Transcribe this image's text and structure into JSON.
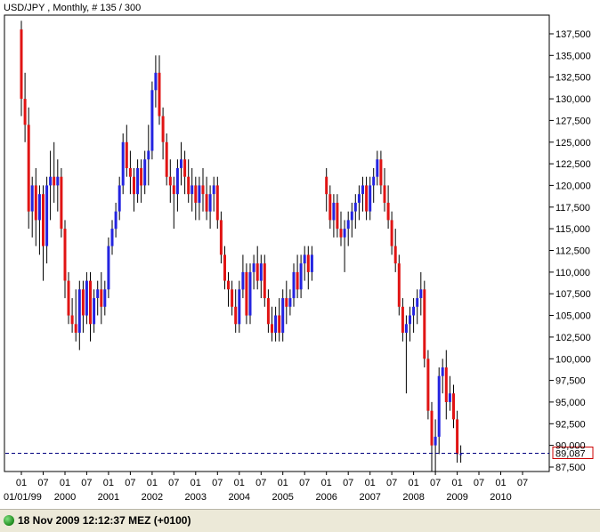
{
  "window": {
    "title": "USD/JPY , Monthly, # 135 / 300"
  },
  "status": {
    "text": "18 Nov 2009 12:12:37  MEZ (+0100)"
  },
  "colors": {
    "up": "#2424e0",
    "down": "#e01414",
    "wick": "#000000",
    "price_line": "#000080",
    "price_box": "#cc0000"
  },
  "chart_data": {
    "type": "candlestick",
    "symbol": "USD/JPY",
    "timeframe": "Monthly",
    "current_price": 89.087,
    "current_price_label": "89,087",
    "ylim": [
      86.5,
      139
    ],
    "y_ticks": [
      87.5,
      90,
      92.5,
      95,
      97.5,
      100,
      102.5,
      105,
      107.5,
      110,
      112.5,
      115,
      117.5,
      120,
      122.5,
      125,
      127.5,
      130,
      132.5,
      135,
      137.5
    ],
    "y_tick_labels": [
      "87,500",
      "90,000",
      "92,500",
      "95,000",
      "97,500",
      "100,000",
      "102,500",
      "105,000",
      "107,500",
      "110,000",
      "112,500",
      "115,000",
      "117,500",
      "120,000",
      "122,500",
      "125,000",
      "127,500",
      "130,000",
      "132,500",
      "135,000",
      "137,500"
    ],
    "month_ticks": [
      {
        "month": 1,
        "label": "01"
      },
      {
        "month": 7,
        "label": "07"
      },
      {
        "month": 13,
        "label": "01"
      },
      {
        "month": 19,
        "label": "07"
      },
      {
        "month": 25,
        "label": "01"
      },
      {
        "month": 31,
        "label": "07"
      },
      {
        "month": 37,
        "label": "01"
      },
      {
        "month": 43,
        "label": "07"
      },
      {
        "month": 49,
        "label": "01"
      },
      {
        "month": 55,
        "label": "07"
      },
      {
        "month": 61,
        "label": "01"
      },
      {
        "month": 67,
        "label": "07"
      },
      {
        "month": 73,
        "label": "01"
      },
      {
        "month": 79,
        "label": "07"
      },
      {
        "month": 85,
        "label": "01"
      },
      {
        "month": 91,
        "label": "07"
      },
      {
        "month": 97,
        "label": "01"
      },
      {
        "month": 103,
        "label": "07"
      },
      {
        "month": 109,
        "label": "01"
      },
      {
        "month": 115,
        "label": "07"
      },
      {
        "month": 121,
        "label": "01"
      },
      {
        "month": 127,
        "label": "07"
      },
      {
        "month": 133,
        "label": "01"
      },
      {
        "month": 139,
        "label": "07"
      }
    ],
    "year_ticks": [
      {
        "month": 1,
        "label": "01/01/99"
      },
      {
        "month": 13,
        "label": "2000"
      },
      {
        "month": 25,
        "label": "2001"
      },
      {
        "month": 37,
        "label": "2002"
      },
      {
        "month": 49,
        "label": "2003"
      },
      {
        "month": 61,
        "label": "2004"
      },
      {
        "month": 73,
        "label": "2005"
      },
      {
        "month": 85,
        "label": "2006"
      },
      {
        "month": 97,
        "label": "2007"
      },
      {
        "month": 109,
        "label": "2008"
      },
      {
        "month": 121,
        "label": "2009"
      },
      {
        "month": 133,
        "label": "2010"
      }
    ],
    "candles": [
      [
        138,
        139,
        128,
        130
      ],
      [
        130,
        133,
        125,
        127
      ],
      [
        127,
        129,
        115,
        117
      ],
      [
        117,
        121,
        114,
        120
      ],
      [
        120,
        122,
        113,
        116
      ],
      [
        116,
        120,
        112,
        119
      ],
      [
        119,
        120,
        109,
        113
      ],
      [
        113,
        121,
        111,
        120
      ],
      [
        120,
        124,
        116,
        121
      ],
      [
        121,
        125,
        118,
        120
      ],
      [
        120,
        123,
        117,
        121
      ],
      [
        121,
        122,
        114,
        115
      ],
      [
        115,
        116,
        107,
        109
      ],
      [
        109,
        110,
        104,
        105
      ],
      [
        105,
        107,
        103,
        104
      ],
      [
        104,
        108,
        102,
        103
      ],
      [
        103,
        109,
        101,
        108
      ],
      [
        108,
        109,
        103,
        105
      ],
      [
        105,
        110,
        104,
        109
      ],
      [
        109,
        110,
        102,
        104
      ],
      [
        104,
        108,
        103,
        107
      ],
      [
        107,
        109,
        105,
        108
      ],
      [
        108,
        110,
        104,
        106
      ],
      [
        106,
        109,
        105,
        108
      ],
      [
        108,
        114,
        107,
        113
      ],
      [
        113,
        116,
        112,
        115
      ],
      [
        115,
        118,
        114,
        117
      ],
      [
        117,
        121,
        116,
        120
      ],
      [
        120,
        126,
        119,
        125
      ],
      [
        125,
        127,
        121,
        122
      ],
      [
        122,
        124,
        119,
        121
      ],
      [
        121,
        122,
        117,
        119
      ],
      [
        119,
        123,
        118,
        122
      ],
      [
        122,
        123,
        118,
        120
      ],
      [
        120,
        124,
        119,
        123
      ],
      [
        123,
        127,
        120,
        124
      ],
      [
        124,
        132,
        123,
        131
      ],
      [
        131,
        135,
        129,
        133
      ],
      [
        133,
        135,
        127,
        128
      ],
      [
        128,
        129,
        123,
        125
      ],
      [
        125,
        126,
        120,
        121
      ],
      [
        121,
        123,
        118,
        120
      ],
      [
        120,
        121,
        115,
        119
      ],
      [
        119,
        123,
        117,
        122
      ],
      [
        122,
        125,
        120,
        123
      ],
      [
        123,
        124,
        119,
        121
      ],
      [
        121,
        123,
        118,
        119
      ],
      [
        119,
        122,
        117,
        120
      ],
      [
        120,
        121,
        116,
        118
      ],
      [
        118,
        121,
        116,
        120
      ],
      [
        120,
        122,
        117,
        119
      ],
      [
        119,
        121,
        116,
        117
      ],
      [
        117,
        120,
        115,
        119
      ],
      [
        119,
        121,
        117,
        120
      ],
      [
        120,
        121,
        115,
        116
      ],
      [
        116,
        117,
        111,
        112
      ],
      [
        112,
        113,
        108,
        109
      ],
      [
        109,
        110,
        106,
        108
      ],
      [
        108,
        109,
        105,
        106
      ],
      [
        106,
        108,
        103,
        104
      ],
      [
        104,
        109,
        103,
        108
      ],
      [
        108,
        112,
        107,
        110
      ],
      [
        110,
        111,
        104,
        105
      ],
      [
        105,
        111,
        104,
        110
      ],
      [
        110,
        112,
        108,
        111
      ],
      [
        111,
        113,
        108,
        109
      ],
      [
        109,
        112,
        107,
        111
      ],
      [
        111,
        112,
        106,
        107
      ],
      [
        107,
        108,
        103,
        104
      ],
      [
        104,
        106,
        102,
        103
      ],
      [
        103,
        106,
        102,
        105
      ],
      [
        105,
        107,
        102,
        103
      ],
      [
        103,
        108,
        102,
        107
      ],
      [
        107,
        109,
        104,
        106
      ],
      [
        106,
        108,
        105,
        107
      ],
      [
        107,
        111,
        106,
        110
      ],
      [
        110,
        112,
        107,
        108
      ],
      [
        108,
        112,
        107,
        111
      ],
      [
        111,
        113,
        109,
        112
      ],
      [
        112,
        113,
        108,
        110
      ],
      [
        110,
        113,
        109,
        112
      ],
      [
        null,
        null,
        null,
        null
      ],
      [
        null,
        null,
        null,
        null
      ],
      [
        null,
        null,
        null,
        null
      ],
      [
        121,
        122,
        117,
        119
      ],
      [
        119,
        120,
        115,
        116
      ],
      [
        116,
        119,
        114,
        118
      ],
      [
        118,
        119,
        114,
        115
      ],
      [
        115,
        117,
        113,
        114
      ],
      [
        114,
        116,
        110,
        115
      ],
      [
        115,
        117,
        113,
        116
      ],
      [
        116,
        118,
        114,
        117
      ],
      [
        117,
        119,
        115,
        118
      ],
      [
        118,
        120,
        116,
        119
      ],
      [
        119,
        121,
        117,
        120
      ],
      [
        120,
        121,
        116,
        117
      ],
      [
        117,
        121,
        116,
        120
      ],
      [
        120,
        122,
        118,
        121
      ],
      [
        121,
        124,
        120,
        123
      ],
      [
        123,
        124,
        119,
        120
      ],
      [
        120,
        122,
        117,
        118
      ],
      [
        118,
        120,
        115,
        116
      ],
      [
        116,
        117,
        112,
        113
      ],
      [
        113,
        115,
        110,
        111
      ],
      [
        111,
        112,
        105,
        106
      ],
      [
        106,
        107,
        102,
        103
      ],
      [
        103,
        105,
        96,
        104
      ],
      [
        104,
        106,
        102,
        105
      ],
      [
        105,
        107,
        103,
        106
      ],
      [
        106,
        108,
        104,
        107
      ],
      [
        107,
        110,
        105,
        108
      ],
      [
        108,
        109,
        99,
        100
      ],
      [
        100,
        101,
        93,
        94
      ],
      [
        94,
        95,
        87,
        90
      ],
      [
        90,
        93,
        87,
        91
      ],
      [
        91,
        99,
        89,
        98
      ],
      [
        98,
        100,
        96,
        99
      ],
      [
        99,
        101,
        93,
        95
      ],
      [
        95,
        98,
        94,
        96
      ],
      [
        96,
        97,
        92,
        93
      ],
      [
        93,
        94,
        88,
        89
      ],
      [
        89,
        90,
        88,
        89
      ]
    ]
  }
}
